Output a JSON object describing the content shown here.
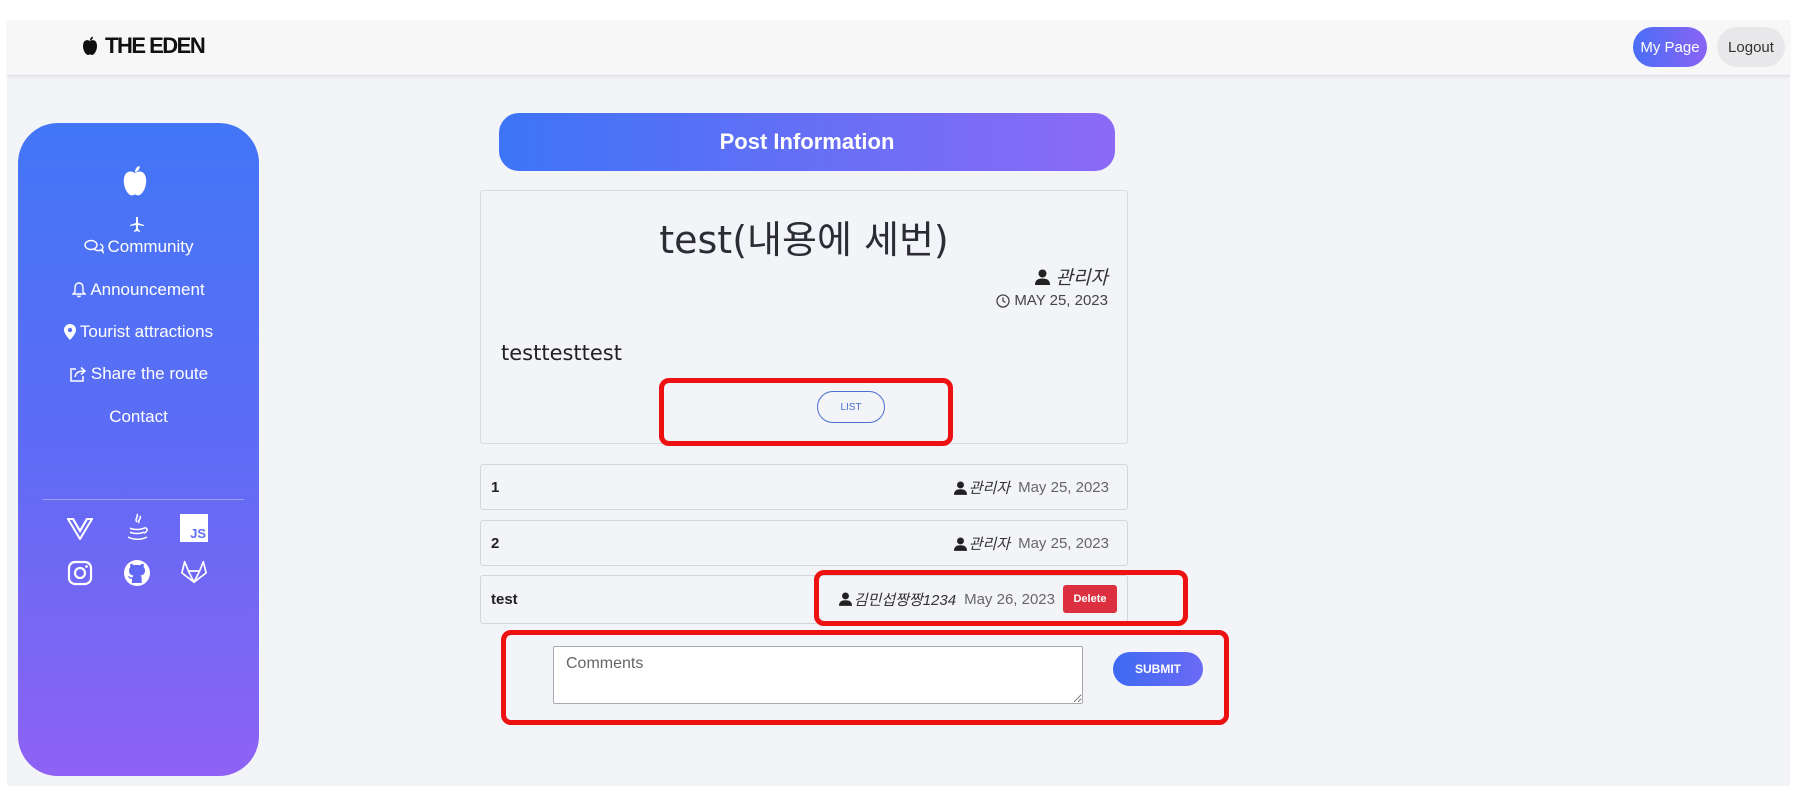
{
  "header": {
    "brand": "THE EDEN",
    "my_page": "My Page",
    "logout": "Logout"
  },
  "sidebar": {
    "items": [
      {
        "label": "Community",
        "icon": "chat-bubbles-icon"
      },
      {
        "label": "Announcement",
        "icon": "bell-icon"
      },
      {
        "label": "Tourist attractions",
        "icon": "map-pin-icon"
      },
      {
        "label": "Share the route",
        "icon": "share-icon"
      },
      {
        "label": "Contact",
        "icon": ""
      }
    ],
    "tech_icons": [
      "vue-icon",
      "java-icon",
      "javascript-icon"
    ],
    "social_icons": [
      "instagram-icon",
      "github-icon",
      "gitlab-icon"
    ],
    "js_label": "JS"
  },
  "post": {
    "section_title": "Post Information",
    "title": "test(내용에 세번)",
    "author": "관리자",
    "date": "MAY 25, 2023",
    "body": "testtesttest",
    "list_button": "LIST"
  },
  "comments": [
    {
      "text": "1",
      "author": "관리자",
      "date": "May 25, 2023",
      "deletable": false
    },
    {
      "text": "2",
      "author": "관리자",
      "date": "May 25, 2023",
      "deletable": false
    },
    {
      "text": "test",
      "author": "김민섭짱짱1234",
      "date": "May 26, 2023",
      "deletable": true,
      "delete_label": "Delete"
    }
  ],
  "comment_form": {
    "placeholder": "Comments",
    "submit": "SUBMIT"
  },
  "colors": {
    "accent_start": "#4276f6",
    "accent_end": "#8e62f4",
    "delete": "#dc3040",
    "highlight": "#ee1111"
  }
}
